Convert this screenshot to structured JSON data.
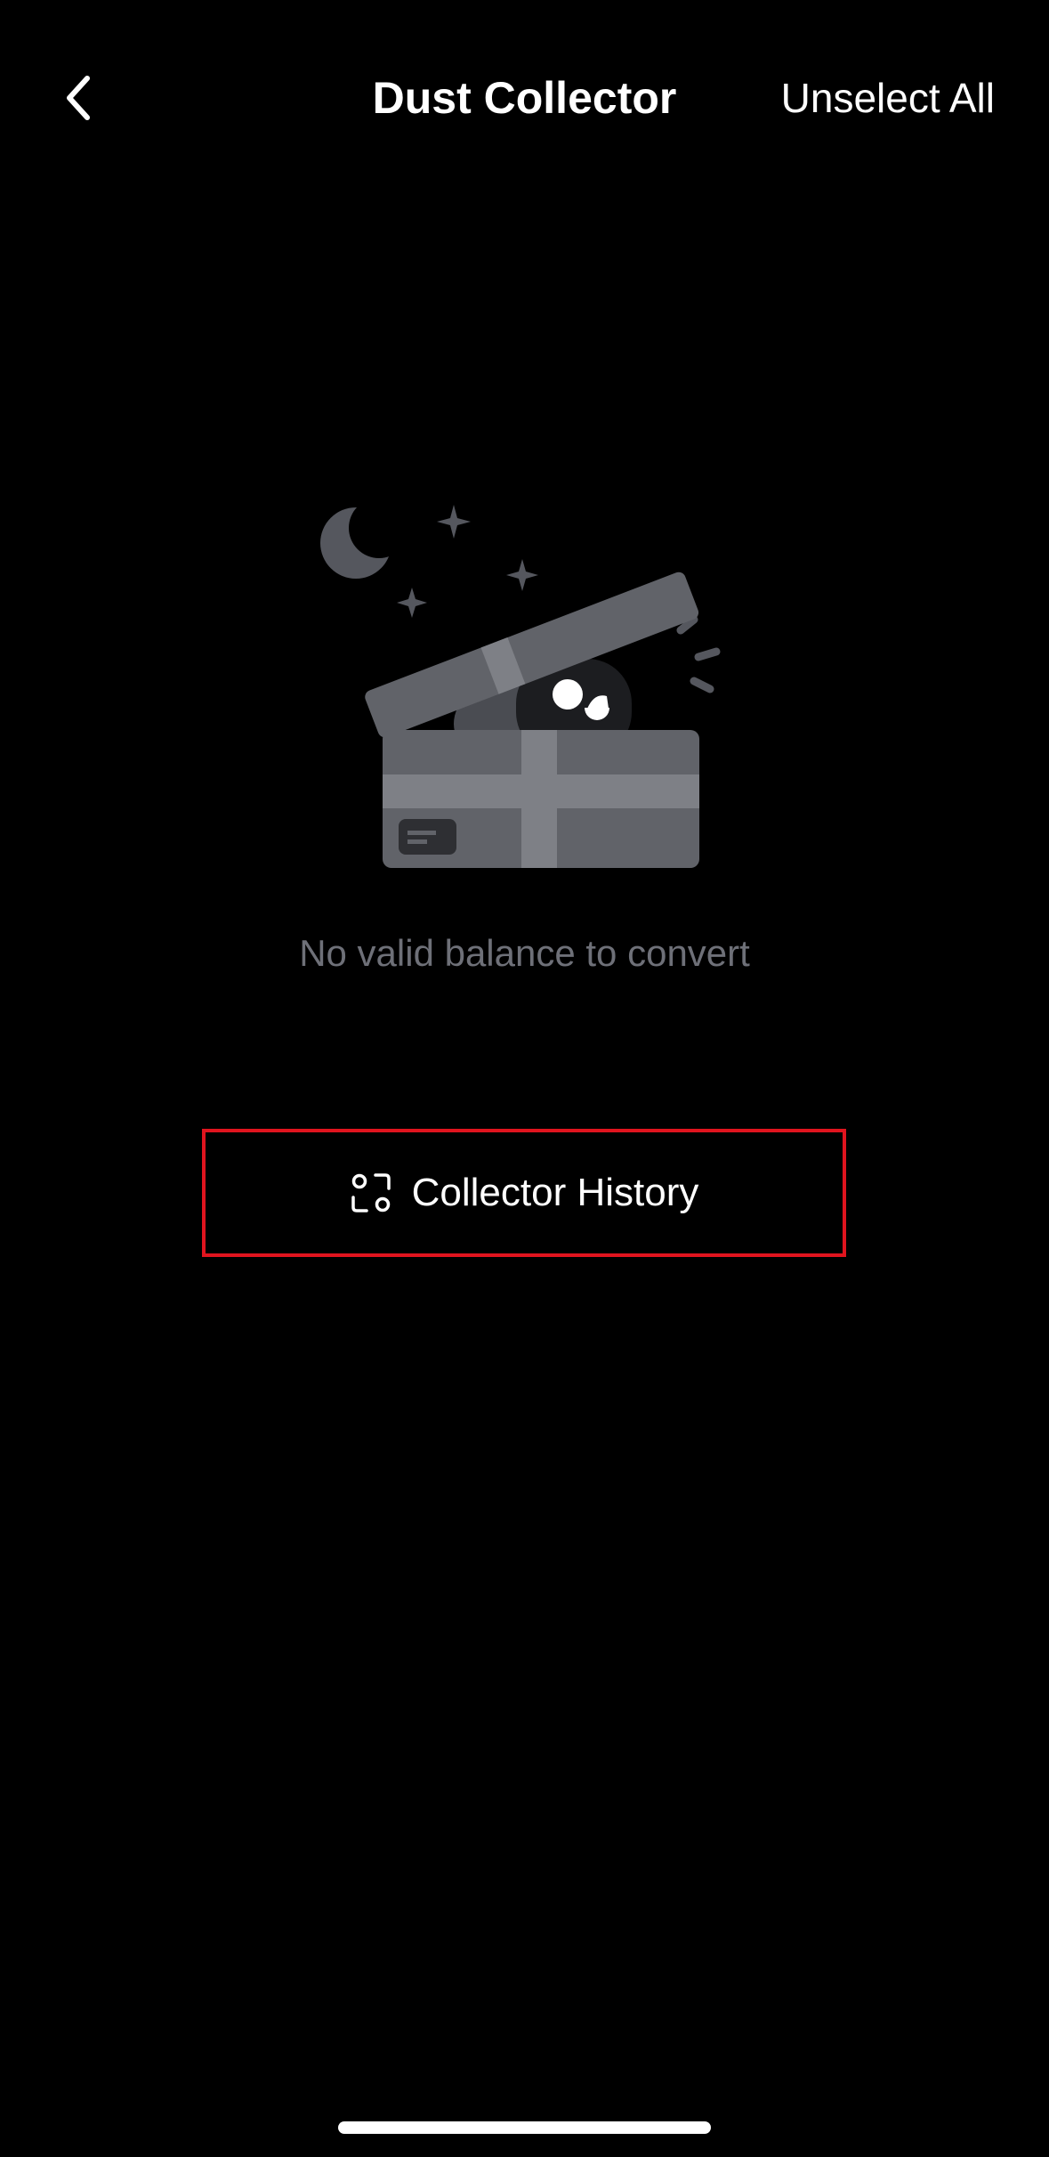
{
  "header": {
    "title": "Dust Collector",
    "back_icon": "chevron-left-icon",
    "unselect_all_label": "Unselect All"
  },
  "empty_state": {
    "illustration": "open-gift-box-robot-illustration",
    "message": "No valid balance to convert"
  },
  "history_button": {
    "icon": "history-records-icon",
    "label": "Collector History"
  },
  "colors": {
    "background": "#000000",
    "text_primary": "#ffffff",
    "text_muted": "#6e7078",
    "highlight_border": "#e0141e"
  }
}
